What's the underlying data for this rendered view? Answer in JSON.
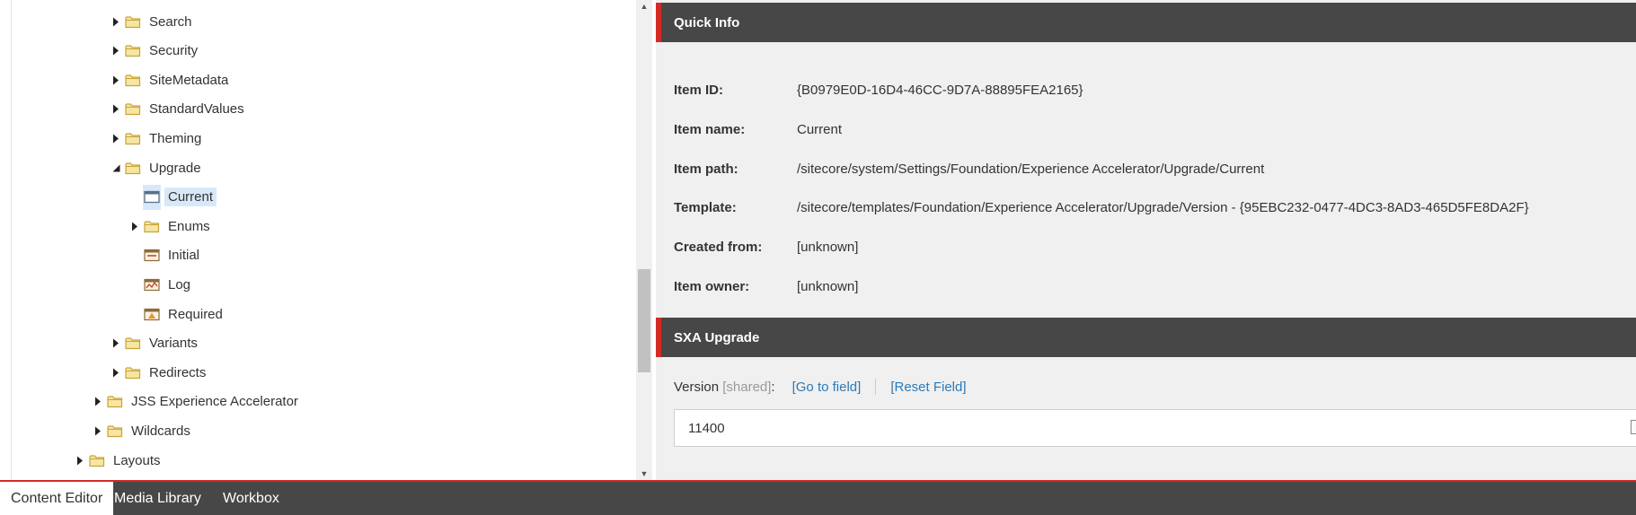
{
  "tree": {
    "items": [
      {
        "label": "Search",
        "icon": "folder-icon",
        "expand": "collapsed",
        "level": 4
      },
      {
        "label": "Security",
        "icon": "folder-icon",
        "expand": "collapsed",
        "level": 4
      },
      {
        "label": "SiteMetadata",
        "icon": "folder-icon",
        "expand": "collapsed",
        "level": 4
      },
      {
        "label": "StandardValues",
        "icon": "folder-icon",
        "expand": "collapsed",
        "level": 4
      },
      {
        "label": "Theming",
        "icon": "folder-icon",
        "expand": "collapsed",
        "level": 4
      },
      {
        "label": "Upgrade",
        "icon": "folder-icon",
        "expand": "expanded",
        "level": 4
      },
      {
        "label": "Current",
        "icon": "template-icon",
        "expand": "none",
        "level": 5,
        "selected": true
      },
      {
        "label": "Enums",
        "icon": "folder-icon",
        "expand": "collapsed",
        "level": 5
      },
      {
        "label": "Initial",
        "icon": "initial-item-icon",
        "expand": "none",
        "level": 5
      },
      {
        "label": "Log",
        "icon": "log-item-icon",
        "expand": "none",
        "level": 5
      },
      {
        "label": "Required",
        "icon": "required-item-icon",
        "expand": "none",
        "level": 5
      },
      {
        "label": "Variants",
        "icon": "folder-icon",
        "expand": "collapsed",
        "level": 4
      },
      {
        "label": "Redirects",
        "icon": "folder-icon",
        "expand": "collapsed",
        "level": 4
      },
      {
        "label": "JSS Experience Accelerator",
        "icon": "folder-icon",
        "expand": "collapsed",
        "level": 3
      },
      {
        "label": "Wildcards",
        "icon": "folder-icon",
        "expand": "collapsed",
        "level": 3
      },
      {
        "label": "Layouts",
        "icon": "folder-icon",
        "expand": "collapsed",
        "level": 2
      }
    ]
  },
  "quick_info": {
    "title": "Quick Info",
    "rows": [
      {
        "key": "Item ID:",
        "value": "{B0979E0D-16D4-46CC-9D7A-88895FEA2165}"
      },
      {
        "key": "Item name:",
        "value": "Current"
      },
      {
        "key": "Item path:",
        "value": "/sitecore/system/Settings/Foundation/Experience Accelerator/Upgrade/Current"
      },
      {
        "key": "Template:",
        "value": "/sitecore/templates/Foundation/Experience Accelerator/Upgrade/Version - {95EBC232-0477-4DC3-8AD3-465D5FE8DA2F}"
      },
      {
        "key": "Created from:",
        "value": "[unknown]"
      },
      {
        "key": "Item owner:",
        "value": "[unknown]"
      }
    ]
  },
  "sxa_upgrade": {
    "title": "SXA Upgrade",
    "field_label": "Version",
    "shared_tag": "[shared]",
    "colon": ":",
    "goto_link": "[Go to field]",
    "reset_link": "[Reset Field]",
    "value": "11400"
  },
  "bottom_tabs": [
    {
      "label": "Content Editor",
      "active": true
    },
    {
      "label": "Media Library",
      "active": false
    },
    {
      "label": "Workbox",
      "active": false
    }
  ],
  "colors": {
    "accent": "#d42a25",
    "header_bg": "#474747",
    "link": "#2b7ab8",
    "selection": "#d7e9f8"
  }
}
